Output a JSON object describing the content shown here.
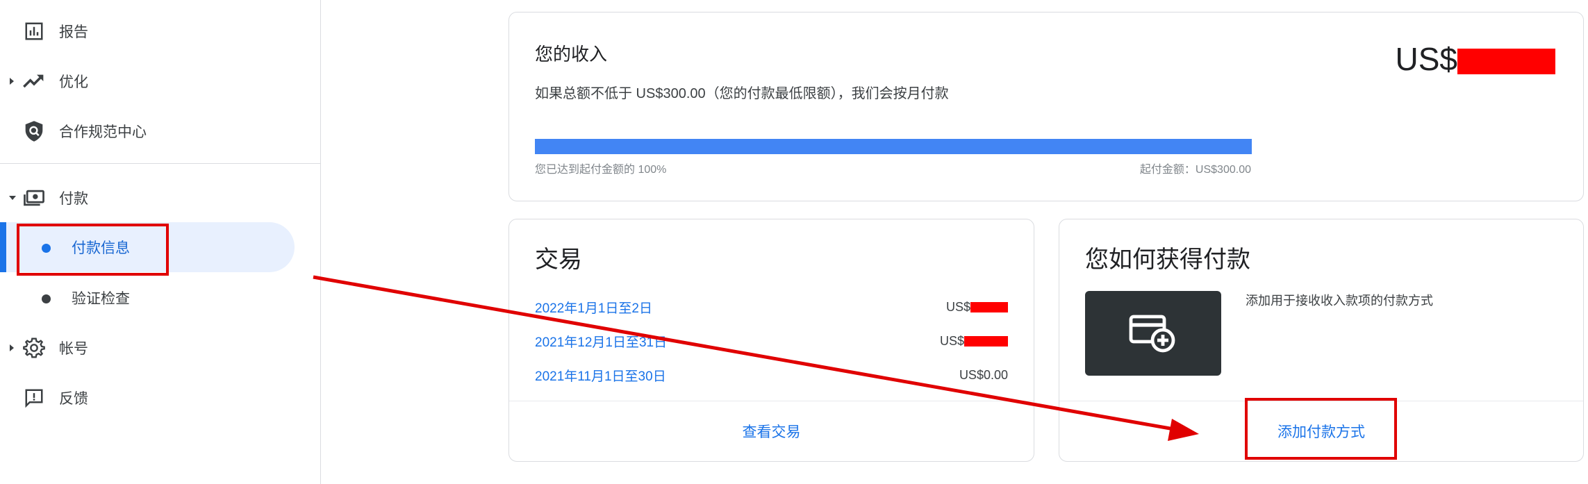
{
  "sidebar": {
    "items": [
      {
        "label": "报告",
        "icon": "report-bar-chart-icon"
      },
      {
        "label": "优化",
        "icon": "trending-up-icon"
      },
      {
        "label": "合作规范中心",
        "icon": "policy-shield-icon"
      }
    ],
    "payments": {
      "label": "付款",
      "icon": "payments-money-icon",
      "sub_items": [
        {
          "label": "付款信息",
          "active": true
        },
        {
          "label": "验证检查",
          "active": false
        }
      ]
    },
    "bottom_items": [
      {
        "label": "帐号",
        "icon": "gear-icon"
      },
      {
        "label": "反馈",
        "icon": "feedback-icon"
      }
    ]
  },
  "earnings": {
    "title": "您的收入",
    "description": "如果总额不低于 US$300.00（您的付款最低限额），我们会按月付款",
    "amount_prefix": "US$",
    "progress_percent": 100,
    "progress_left_label": "您已达到起付金额的 100%",
    "progress_right_label": "起付金额：US$300.00"
  },
  "transactions": {
    "title": "交易",
    "rows": [
      {
        "period": "2022年1月1日至2日",
        "amount_prefix": "US$",
        "amount": "",
        "redacted": true
      },
      {
        "period": "2021年12月1日至31日",
        "amount_prefix": "US$",
        "amount": "",
        "redacted": true
      },
      {
        "period": "2021年11月1日至30日",
        "amount_prefix": "",
        "amount": "US$0.00",
        "redacted": false
      }
    ],
    "footer_link": "查看交易"
  },
  "payment_method": {
    "title": "您如何获得付款",
    "description": "添加用于接收收入款项的付款方式",
    "icon": "add-card-icon",
    "footer_link": "添加付款方式"
  },
  "colors": {
    "accent": "#1a73e8",
    "progress": "#4285f4",
    "annotation": "#e00000",
    "active_bg": "#e8f0fe",
    "tile": "#2d3336"
  }
}
